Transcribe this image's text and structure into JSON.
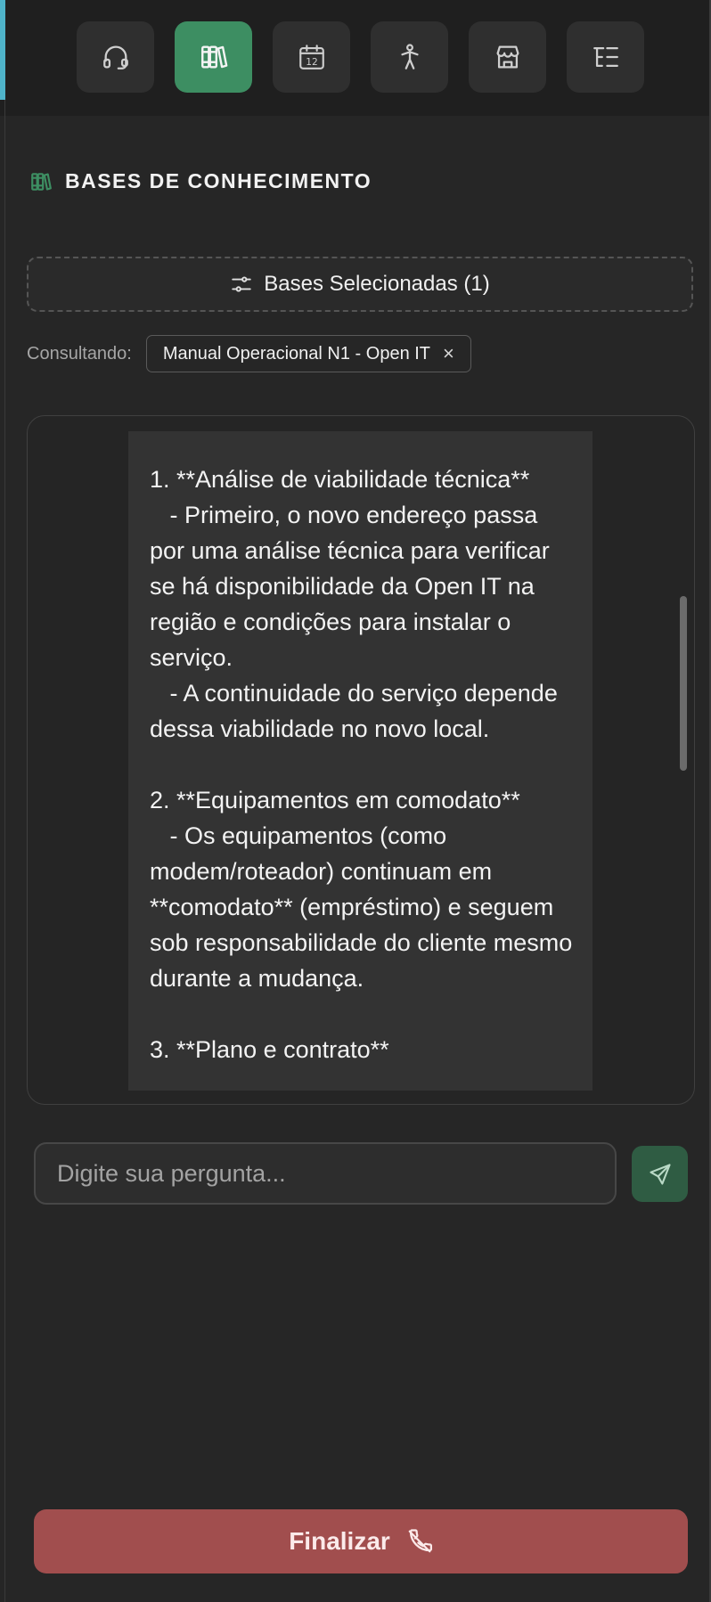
{
  "toolbar": {
    "buttons": [
      {
        "icon": "headset-icon",
        "active": false
      },
      {
        "icon": "books-icon",
        "active": true
      },
      {
        "icon": "calendar-icon",
        "active": false,
        "calendar_number": "12"
      },
      {
        "icon": "person-icon",
        "active": false
      },
      {
        "icon": "store-icon",
        "active": false
      },
      {
        "icon": "list-tree-icon",
        "active": false
      }
    ]
  },
  "section": {
    "title": "BASES DE CONHECIMENTO",
    "icon": "books-icon"
  },
  "bases_button": {
    "label": "Bases Selecionadas (1)",
    "icon": "sliders-icon"
  },
  "consulting": {
    "label": "Consultando:",
    "chip_label": "Manual Operacional N1 - Open IT",
    "chip_close": "×"
  },
  "chat": {
    "message": "1. **Análise de viabilidade técnica**\n   - Primeiro, o novo endereço passa por uma análise técnica para verificar se há disponibilidade da Open IT na região e condições para instalar o serviço.\n   - A continuidade do serviço depende dessa viabilidade no novo local.\n\n2. **Equipamentos em comodato**\n   - Os equipamentos (como modem/roteador) continuam em **comodato** (empréstimo) e seguem sob responsabilidade do cliente mesmo durante a mudança.\n\n3. **Plano e contrato**"
  },
  "input": {
    "placeholder": "Digite sua pergunta...",
    "value": ""
  },
  "send_button": {
    "icon": "send-icon"
  },
  "finalizar_button": {
    "label": "Finalizar",
    "icon": "phone-off-icon"
  },
  "colors": {
    "accent_green": "#3d8e62",
    "danger_red": "#a14e4e",
    "background": "#262626",
    "left_accent": "#4fb3c9"
  }
}
